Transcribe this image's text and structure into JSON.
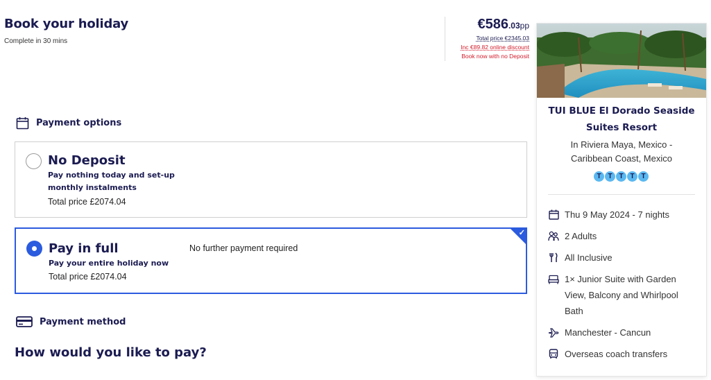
{
  "header": {
    "title": "Book your holiday",
    "subtitle": "Complete in 30 mins"
  },
  "price": {
    "currency": "€",
    "amount_whole": "586",
    "amount_decimal": ".03",
    "per": "pp",
    "total_price": "Total price €2345.03",
    "discount": "Inc €89.82 online discount",
    "no_deposit_note": "Book now with no Deposit"
  },
  "payment_options": {
    "title": "Payment options",
    "icon": "calendar-icon",
    "options": [
      {
        "title": "No Deposit",
        "description": "Pay nothing today and set-up monthly instalments",
        "total": "Total price £2074.04",
        "selected": false
      },
      {
        "title": "Pay in full",
        "description": "Pay your entire holiday now",
        "total": "Total price £2074.04",
        "note": "No further payment required",
        "selected": true
      }
    ]
  },
  "payment_method": {
    "title": "Payment method",
    "icon": "credit-card-icon",
    "question": "How would you like to pay?"
  },
  "hotel": {
    "name": "TUI BLUE El Dorado Seaside Suites Resort",
    "location": "In Riviera Maya, Mexico - Caribbean Coast, Mexico",
    "rating": 5,
    "rating_glyph": "T",
    "details": [
      {
        "icon": "calendar-icon",
        "text": "Thu 9 May 2024 - 7 nights"
      },
      {
        "icon": "people-icon",
        "text": "2 Adults"
      },
      {
        "icon": "cutlery-icon",
        "text": "All Inclusive"
      },
      {
        "icon": "bed-icon",
        "text": "1× Junior Suite with Garden View, Balcony and Whirlpool Bath"
      },
      {
        "icon": "plane-icon",
        "text": "Manchester - Cancun"
      },
      {
        "icon": "bus-icon",
        "text": "Overseas coach transfers"
      }
    ]
  },
  "colors": {
    "navy": "#1b1b52",
    "accent_blue": "#2b5bde",
    "red": "#d21d2b",
    "rating_blue": "#5bb8f0"
  }
}
